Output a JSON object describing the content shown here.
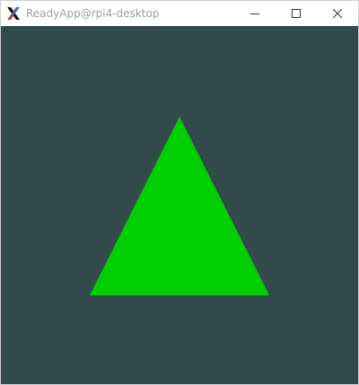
{
  "window": {
    "title": "ReadyApp@rpi4-desktop",
    "app_icon": "x11-icon",
    "title_color": "#9aa0a6",
    "controls": [
      {
        "name": "minimize-button",
        "icon": "minimize-icon"
      },
      {
        "name": "maximize-button",
        "icon": "maximize-icon"
      },
      {
        "name": "close-button",
        "icon": "close-icon"
      }
    ]
  },
  "canvas": {
    "background_color": "#334a4d",
    "shape": "triangle",
    "shape_color": "#00d000"
  }
}
